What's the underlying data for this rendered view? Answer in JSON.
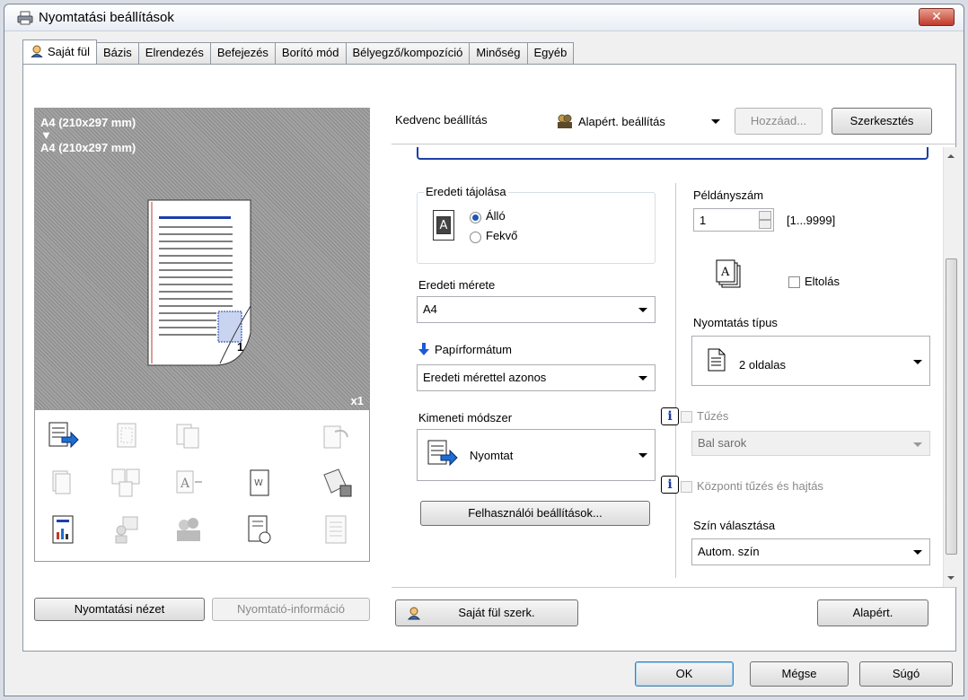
{
  "window": {
    "title": "Nyomtatási beállítások",
    "close_label": "✕"
  },
  "tabs": [
    {
      "label": "Saját fül",
      "active": true
    },
    {
      "label": "Bázis"
    },
    {
      "label": "Elrendezés"
    },
    {
      "label": "Befejezés"
    },
    {
      "label": "Borító mód"
    },
    {
      "label": "Bélyegző/kompozíció"
    },
    {
      "label": "Minőség"
    },
    {
      "label": "Egyéb"
    }
  ],
  "preview": {
    "source_size": "A4 (210x297 mm)",
    "arrow": "▼",
    "target_size": "A4 (210x297 mm)",
    "page_number": "1",
    "copies_badge": "x1"
  },
  "left_buttons": {
    "print_view": "Nyomtatási nézet",
    "printer_info": "Nyomtató-információ"
  },
  "favorites": {
    "label": "Kedvenc beállítás",
    "selected": "Alapért. beállítás",
    "add_label": "Hozzáad...",
    "edit_label": "Szerkesztés"
  },
  "orientation": {
    "group_label": "Eredeti tájolása",
    "portrait": "Álló",
    "landscape": "Fekvő",
    "selected": "portrait",
    "icon_letter": "A"
  },
  "original_size": {
    "label": "Eredeti mérete",
    "value": "A4"
  },
  "paper_size": {
    "label": "Papírformátum",
    "value": "Eredeti mérettel azonos"
  },
  "output_method": {
    "label": "Kimeneti módszer",
    "value": "Nyomtat"
  },
  "user_settings_button": "Felhasználói beállítások...",
  "copies": {
    "label": "Példányszám",
    "value": "1",
    "range": "[1...9999]"
  },
  "offset": {
    "label": "Eltolás",
    "checked": false,
    "icon_letter": "A"
  },
  "print_type": {
    "label": "Nyomtatás típus",
    "value": "2 oldalas"
  },
  "staple": {
    "label": "Tűzés",
    "value": "Bal sarok",
    "info": "i"
  },
  "center_staple": {
    "label": "Központi tűzés és hajtás",
    "info": "i"
  },
  "color": {
    "label": "Szín választása",
    "value": "Autom. szín"
  },
  "bottom_panel": {
    "tab_edit": "Saját fül szerk.",
    "default": "Alapért."
  },
  "dialog_buttons": {
    "ok": "OK",
    "cancel": "Mégse",
    "help": "Súgó"
  },
  "colors": {
    "accent_blue": "#1c3fa8",
    "close_red": "#c0392b"
  }
}
